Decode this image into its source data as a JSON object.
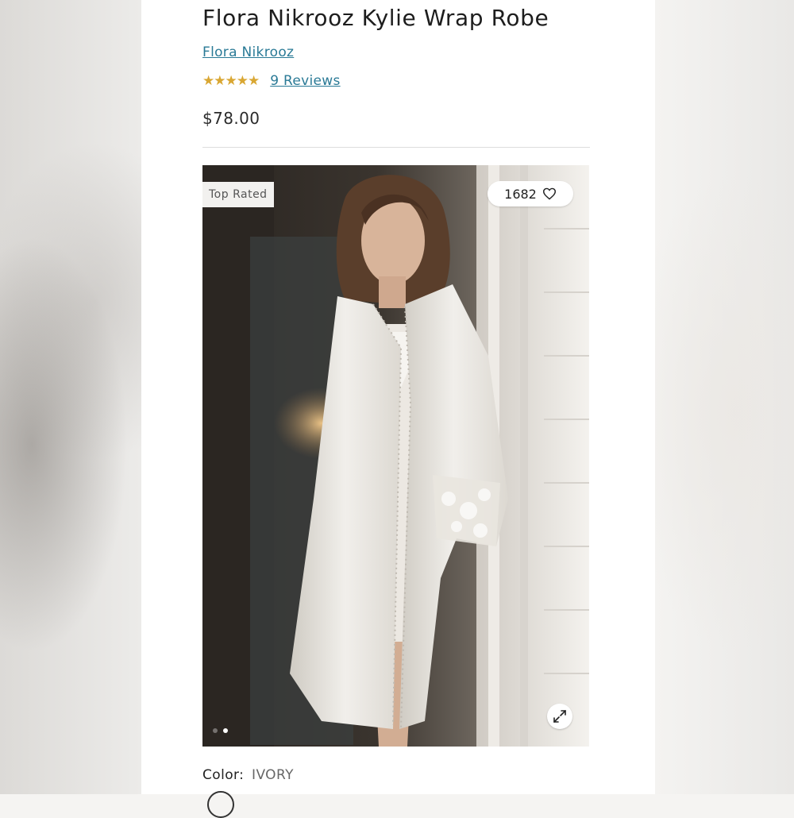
{
  "product": {
    "title": "Flora Nikrooz Kylie Wrap Robe",
    "brand": "Flora Nikrooz",
    "rating_stars": "★★★★★",
    "rating_value": 5,
    "reviews_label": "9 Reviews",
    "price": "$78.00"
  },
  "image": {
    "badge": "Top Rated",
    "favorites_count": "1682",
    "icons": {
      "favorite": "heart-icon",
      "expand": "expand-icon"
    },
    "carousel": {
      "total": 2,
      "active_index": 1
    }
  },
  "color": {
    "label": "Color:",
    "value": "IVORY"
  },
  "colors": {
    "link": "#2a7a96",
    "stars": "#d9a733"
  }
}
